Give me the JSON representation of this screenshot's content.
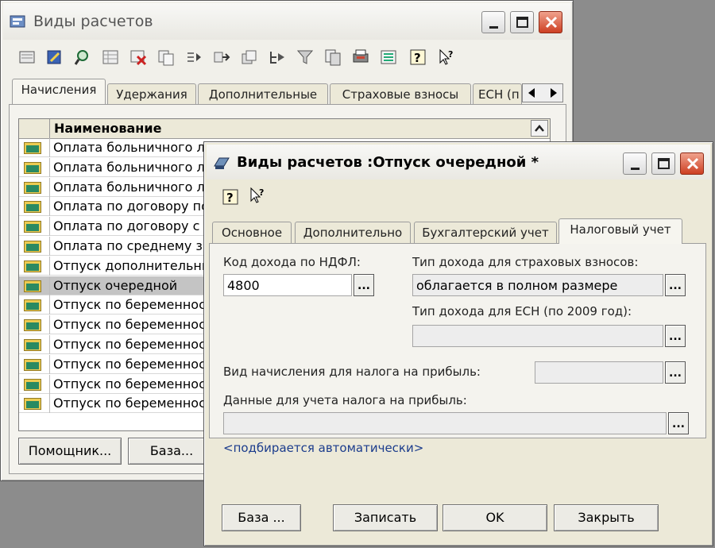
{
  "main_window": {
    "title": "Виды расчетов",
    "tabs": [
      {
        "label": "Начисления"
      },
      {
        "label": "Удержания"
      },
      {
        "label": "Дополнительные"
      },
      {
        "label": "Страховые взносы"
      },
      {
        "label": "ЕСН (п"
      }
    ],
    "list": {
      "column_header": "Наименование",
      "rows": [
        {
          "label": "Оплата больничного л"
        },
        {
          "label": "Оплата больничного л"
        },
        {
          "label": "Оплата больничного л"
        },
        {
          "label": "Оплата по договору по"
        },
        {
          "label": "Оплата по договору с"
        },
        {
          "label": "Оплата по среднему з"
        },
        {
          "label": "Отпуск дополнительны"
        },
        {
          "label": "Отпуск очередной"
        },
        {
          "label": "Отпуск по беременнос"
        },
        {
          "label": "Отпуск по беременнос"
        },
        {
          "label": "Отпуск по беременнос"
        },
        {
          "label": "Отпуск по беременнос"
        },
        {
          "label": "Отпуск по беременнос"
        },
        {
          "label": "Отпуск по беременнос"
        }
      ]
    },
    "buttons": {
      "assistant": "Помощник...",
      "base": "База..."
    }
  },
  "dialog": {
    "title": "Виды расчетов :Отпуск очередной *",
    "tabs": [
      {
        "label": "Основное"
      },
      {
        "label": "Дополнительно"
      },
      {
        "label": "Бухгалтерский учет"
      },
      {
        "label": "Налоговый учет"
      }
    ],
    "fields": {
      "ndfl_code_label": "Код дохода по НДФЛ:",
      "ndfl_code_value": "4800",
      "insurance_type_label": "Тип дохода для страховых взносов:",
      "insurance_type_value": "облагается в полном размере",
      "esn_type_label": "Тип дохода для ЕСН (по 2009 год):",
      "esn_type_value": "",
      "profit_tax_kind_label": "Вид начисления для налога на прибыль:",
      "profit_tax_kind_value": "",
      "profit_tax_data_label": "Данные для учета налога на прибыль:",
      "profit_tax_data_value": "",
      "auto_note": "<подбирается автоматически>",
      "dots": "..."
    },
    "buttons": {
      "base": "База ...",
      "save": "Записать",
      "ok": "OK",
      "close": "Закрыть"
    }
  },
  "colors": {
    "desktop": "#8c8c8c",
    "window_bg": "#ece9d8",
    "close_button": "#cd3f23",
    "link": "#1b3c8c",
    "selected_row": "#c4c4c4"
  }
}
